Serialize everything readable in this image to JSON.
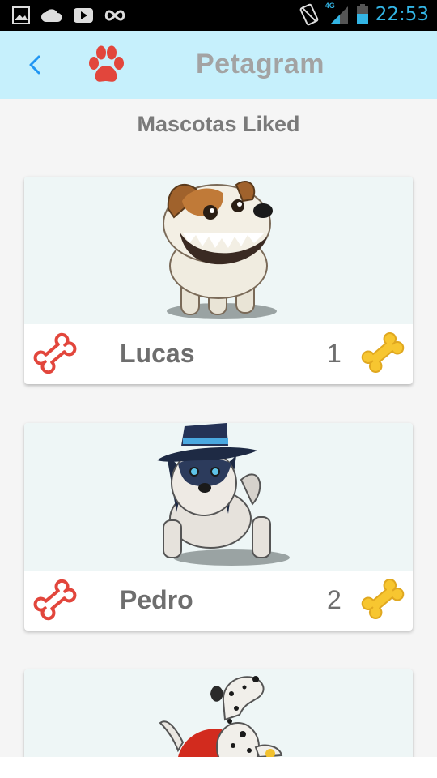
{
  "status_bar": {
    "time": "22:53",
    "network": "4G",
    "icons": [
      "image-icon",
      "cloud-icon",
      "youtube-icon",
      "infinity-icon",
      "vibrate-icon",
      "signal-icon",
      "battery-icon"
    ],
    "time_color": "#33b5e5"
  },
  "app_bar": {
    "title": "Petagram",
    "back_icon": "chevron-left-icon",
    "logo_icon": "paw-icon",
    "background": "#c6f0fc",
    "accent": "#e2463c"
  },
  "section_title": "Mascotas Liked",
  "pets": [
    {
      "name": "Lucas",
      "likes": "1",
      "image": "jack-russell-dog-icon",
      "like_icon": "bone-outline-icon",
      "rating_icon": "bone-gold-icon"
    },
    {
      "name": "Pedro",
      "likes": "2",
      "image": "husky-with-hat-icon",
      "like_icon": "bone-outline-icon",
      "rating_icon": "bone-gold-icon"
    },
    {
      "image": "dalmatian-with-cape-icon"
    }
  ]
}
